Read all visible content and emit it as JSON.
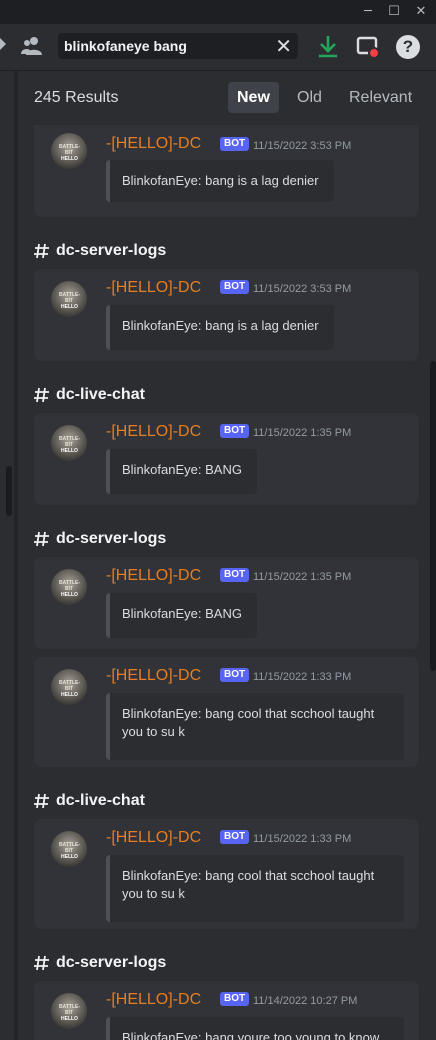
{
  "window": {
    "minimize_glyph": "─",
    "maximize_glyph": "☐",
    "close_glyph": "✕"
  },
  "toolbar": {
    "search_value": "blinkofaneye bang",
    "clear_glyph": "✕",
    "icons": {
      "people": "people-icon",
      "download": "download-icon",
      "screen": "screen-share-icon",
      "help": "help-icon",
      "help_glyph": "?"
    },
    "colors": {
      "download": "#23a55a",
      "notify": "#f23f43"
    }
  },
  "results": {
    "count": "245 Results",
    "sort": {
      "new": "New",
      "old": "Old",
      "relevant": "Relevant",
      "active": "New"
    }
  },
  "channels": [
    "dc-server-logs",
    "dc-live-chat",
    "dc-server-logs",
    "dc-live-chat",
    "dc-server-logs"
  ],
  "avatar": {
    "top_text": "BATTLE-BIT",
    "bottom_text": "HELLO"
  },
  "messages": [
    {
      "author": "-[HELLO]-DC",
      "badge": "BOT",
      "timestamp": "11/15/2022 3:53 PM",
      "text": "BlinkofanEye: bang is a lag denier"
    },
    {
      "author": "-[HELLO]-DC",
      "badge": "BOT",
      "timestamp": "11/15/2022 3:53 PM",
      "text": "BlinkofanEye: bang is a lag denier"
    },
    {
      "author": "-[HELLO]-DC",
      "badge": "BOT",
      "timestamp": "11/15/2022 1:35 PM",
      "text": "BlinkofanEye: BANG"
    },
    {
      "author": "-[HELLO]-DC",
      "badge": "BOT",
      "timestamp": "11/15/2022 1:35 PM",
      "text": "BlinkofanEye: BANG"
    },
    {
      "author": "-[HELLO]-DC",
      "badge": "BOT",
      "timestamp": "11/15/2022 1:33 PM",
      "text": "BlinkofanEye: bang cool that scchool taught you to su k"
    },
    {
      "author": "-[HELLO]-DC",
      "badge": "BOT",
      "timestamp": "11/15/2022 1:33 PM",
      "text": "BlinkofanEye: bang cool that scchool taught you to su k"
    },
    {
      "author": "-[HELLO]-DC",
      "badge": "BOT",
      "timestamp": "11/14/2022 10:27 PM",
      "text": "BlinkofanEye: bang youre too young to know"
    }
  ],
  "colors": {
    "author": "#e67e22",
    "badge": "#5865f2",
    "panel": "#2b2d31",
    "card": "#313338"
  }
}
